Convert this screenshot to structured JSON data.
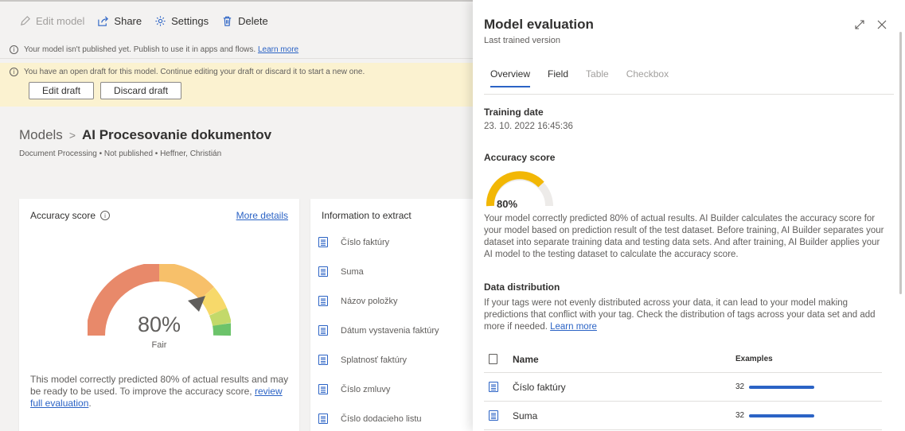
{
  "toolbar": {
    "edit_model": "Edit model",
    "share": "Share",
    "settings": "Settings",
    "delete": "Delete"
  },
  "notices": {
    "unpublished": "Your model isn't published yet. Publish to use it in apps and flows.",
    "unpublished_link": "Learn more",
    "draft": "You have an open draft for this model. Continue editing your draft or discard it to start a new one.",
    "edit_draft": "Edit draft",
    "discard_draft": "Discard draft"
  },
  "breadcrumb": {
    "root": "Models",
    "current": "AI Procesovanie dokumentov"
  },
  "meta": "Document Processing • Not published • Heffner, Christián",
  "accuracy_card": {
    "title": "Accuracy score",
    "more_details": "More details",
    "score": "80%",
    "score_value": 0.8,
    "rating": "Fair",
    "description": "This model correctly predicted 80% of actual results and may be ready to be used. To improve the accuracy score,",
    "link": "review full evaluation",
    "link_suffix": ".",
    "colors": {
      "poor": "#e8896a",
      "fair": "#f7c06a",
      "good1": "#f7d96a",
      "good2": "#c3d96a",
      "great": "#6cc36a",
      "needle": "#605e5c"
    }
  },
  "extract_card": {
    "title": "Information to extract",
    "items": [
      "Číslo faktúry",
      "Suma",
      "Názov položky",
      "Dátum vystavenia faktúry",
      "Splatnosť faktúry",
      "Číslo zmluvy",
      "Číslo dodacieho listu"
    ]
  },
  "panel": {
    "title": "Model evaluation",
    "subtitle": "Last trained version",
    "tabs": [
      "Overview",
      "Field",
      "Table",
      "Checkbox"
    ],
    "training_date_label": "Training date",
    "training_date": "23. 10. 2022 16:45:36",
    "accuracy_label": "Accuracy score",
    "accuracy_value": "80%",
    "accuracy_fraction": 0.8,
    "accuracy_desc": "Your model correctly predicted 80% of actual results. AI Builder calculates the accuracy score for your model based on prediction result of the test dataset. Before training, AI Builder separates your dataset into separate training data and testing data sets. And after training, AI Builder applies your AI model to the testing dataset to calculate the accuracy score.",
    "distribution_label": "Data distribution",
    "distribution_desc": "If your tags were not evenly distributed across your data, it can lead to your model making predictions that conflict with your tag. Check the distribution of tags across your data set and add more if needed.",
    "distribution_link": "Learn more",
    "table": {
      "col_name": "Name",
      "col_examples": "Examples",
      "rows": [
        {
          "name": "Číslo faktúry",
          "examples": "32"
        },
        {
          "name": "Suma",
          "examples": "32"
        }
      ]
    },
    "accent": "#2b63c5",
    "gauge_color": "#f2b705"
  }
}
